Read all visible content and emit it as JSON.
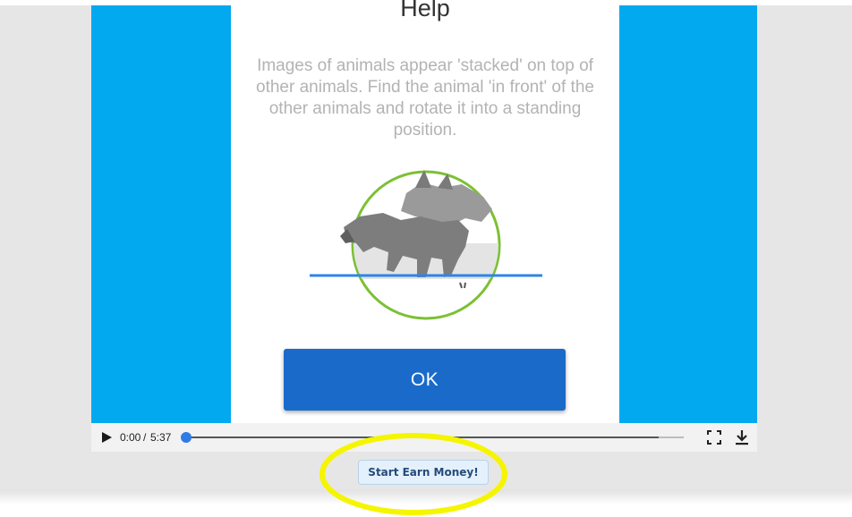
{
  "help": {
    "title": "Help",
    "description": "Images of animals appear 'stacked' on top of other animals. Find the animal 'in front' of the other animals and rotate it into a standing position.",
    "ok_label": "OK"
  },
  "player": {
    "current_time": "0:00",
    "separator": "/",
    "duration": "5:37",
    "loaded_fraction": 0.95,
    "played_fraction": 0
  },
  "cta": {
    "label": "Start Earn Money!"
  },
  "colors": {
    "video_bg": "#03a9ef",
    "ok_button": "#1a6bc9",
    "highlight": "#f5f500",
    "circle": "#7cc034",
    "horizon_line": "#2d86e8"
  }
}
